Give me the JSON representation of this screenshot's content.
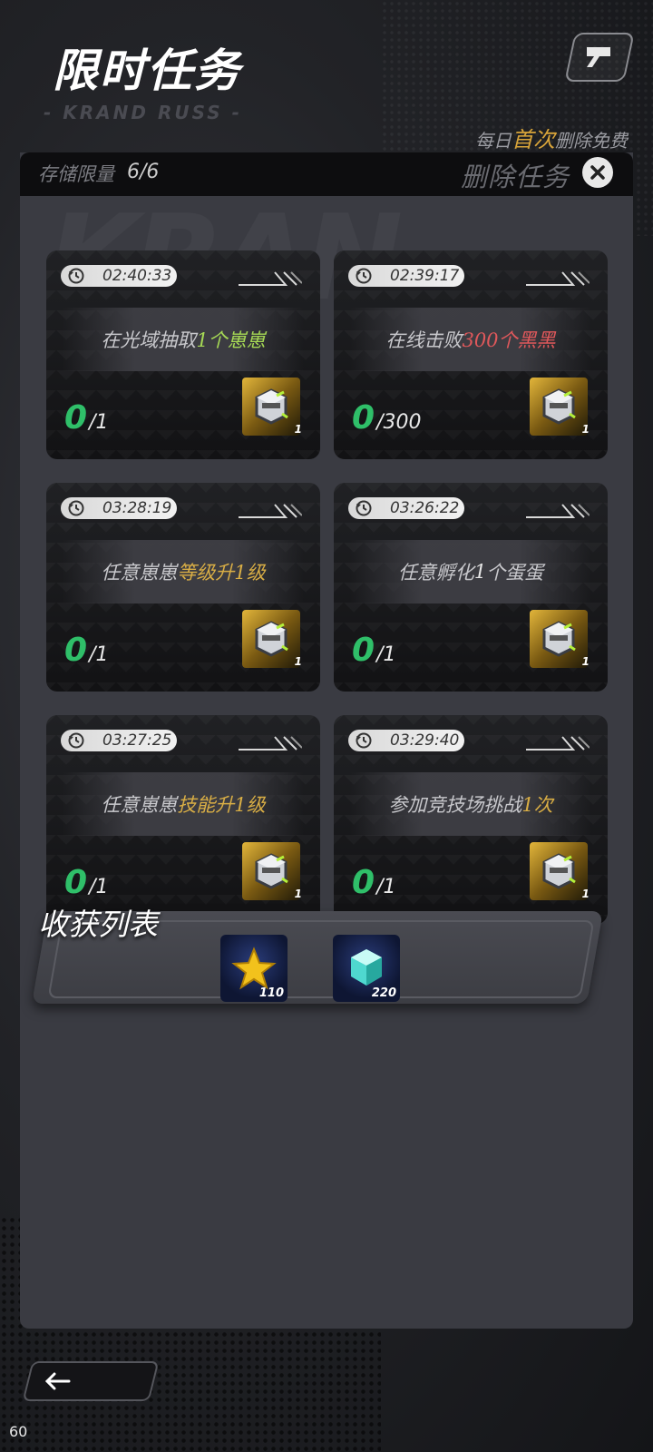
{
  "header": {
    "title": "限时任务",
    "subtitle": "- KRAND RUSS -",
    "hint_prefix": "每日",
    "hint_highlight": "首次",
    "hint_suffix": "删除免费"
  },
  "panel": {
    "storage_label": "存储限量",
    "storage_value": "6/6",
    "delete_label": "删除任务"
  },
  "tasks": [
    {
      "timer": "02:40:33",
      "desc_pre": "在光域抽取",
      "desc_hl": "1个崽崽",
      "desc_post": "",
      "hl_color": "green",
      "current": "0",
      "total": "/1",
      "reward_count": "1"
    },
    {
      "timer": "02:39:17",
      "desc_pre": "在线击败",
      "desc_hl": "300个黑黑",
      "desc_post": "",
      "hl_color": "red",
      "current": "0",
      "total": "/300",
      "reward_count": "1"
    },
    {
      "timer": "03:28:19",
      "desc_pre": "任意崽崽",
      "desc_hl": "等级升1级",
      "desc_post": "",
      "hl_color": "yellow",
      "current": "0",
      "total": "/1",
      "reward_count": "1"
    },
    {
      "timer": "03:26:22",
      "desc_pre": "任意孵化",
      "desc_hl": "1",
      "desc_post": "个蛋蛋",
      "hl_color": "none",
      "current": "0",
      "total": "/1",
      "reward_count": "1"
    },
    {
      "timer": "03:27:25",
      "desc_pre": "任意崽崽",
      "desc_hl": "技能升1级",
      "desc_post": "",
      "hl_color": "yellow",
      "current": "0",
      "total": "/1",
      "reward_count": "1"
    },
    {
      "timer": "03:29:40",
      "desc_pre": "参加竞技场挑战",
      "desc_hl": "1次",
      "desc_post": "",
      "hl_color": "yellow",
      "current": "0",
      "total": "/1",
      "reward_count": "1"
    }
  ],
  "harvest": {
    "title": "收获列表",
    "items": [
      {
        "icon": "star-icon",
        "count": "110"
      },
      {
        "icon": "cube-icon",
        "count": "220"
      }
    ]
  },
  "fps": "60",
  "colors": {
    "accent": "#d9ae45",
    "progress_green": "#2fbf69",
    "hl_red": "#e0585b",
    "hl_green": "#a6d955"
  }
}
